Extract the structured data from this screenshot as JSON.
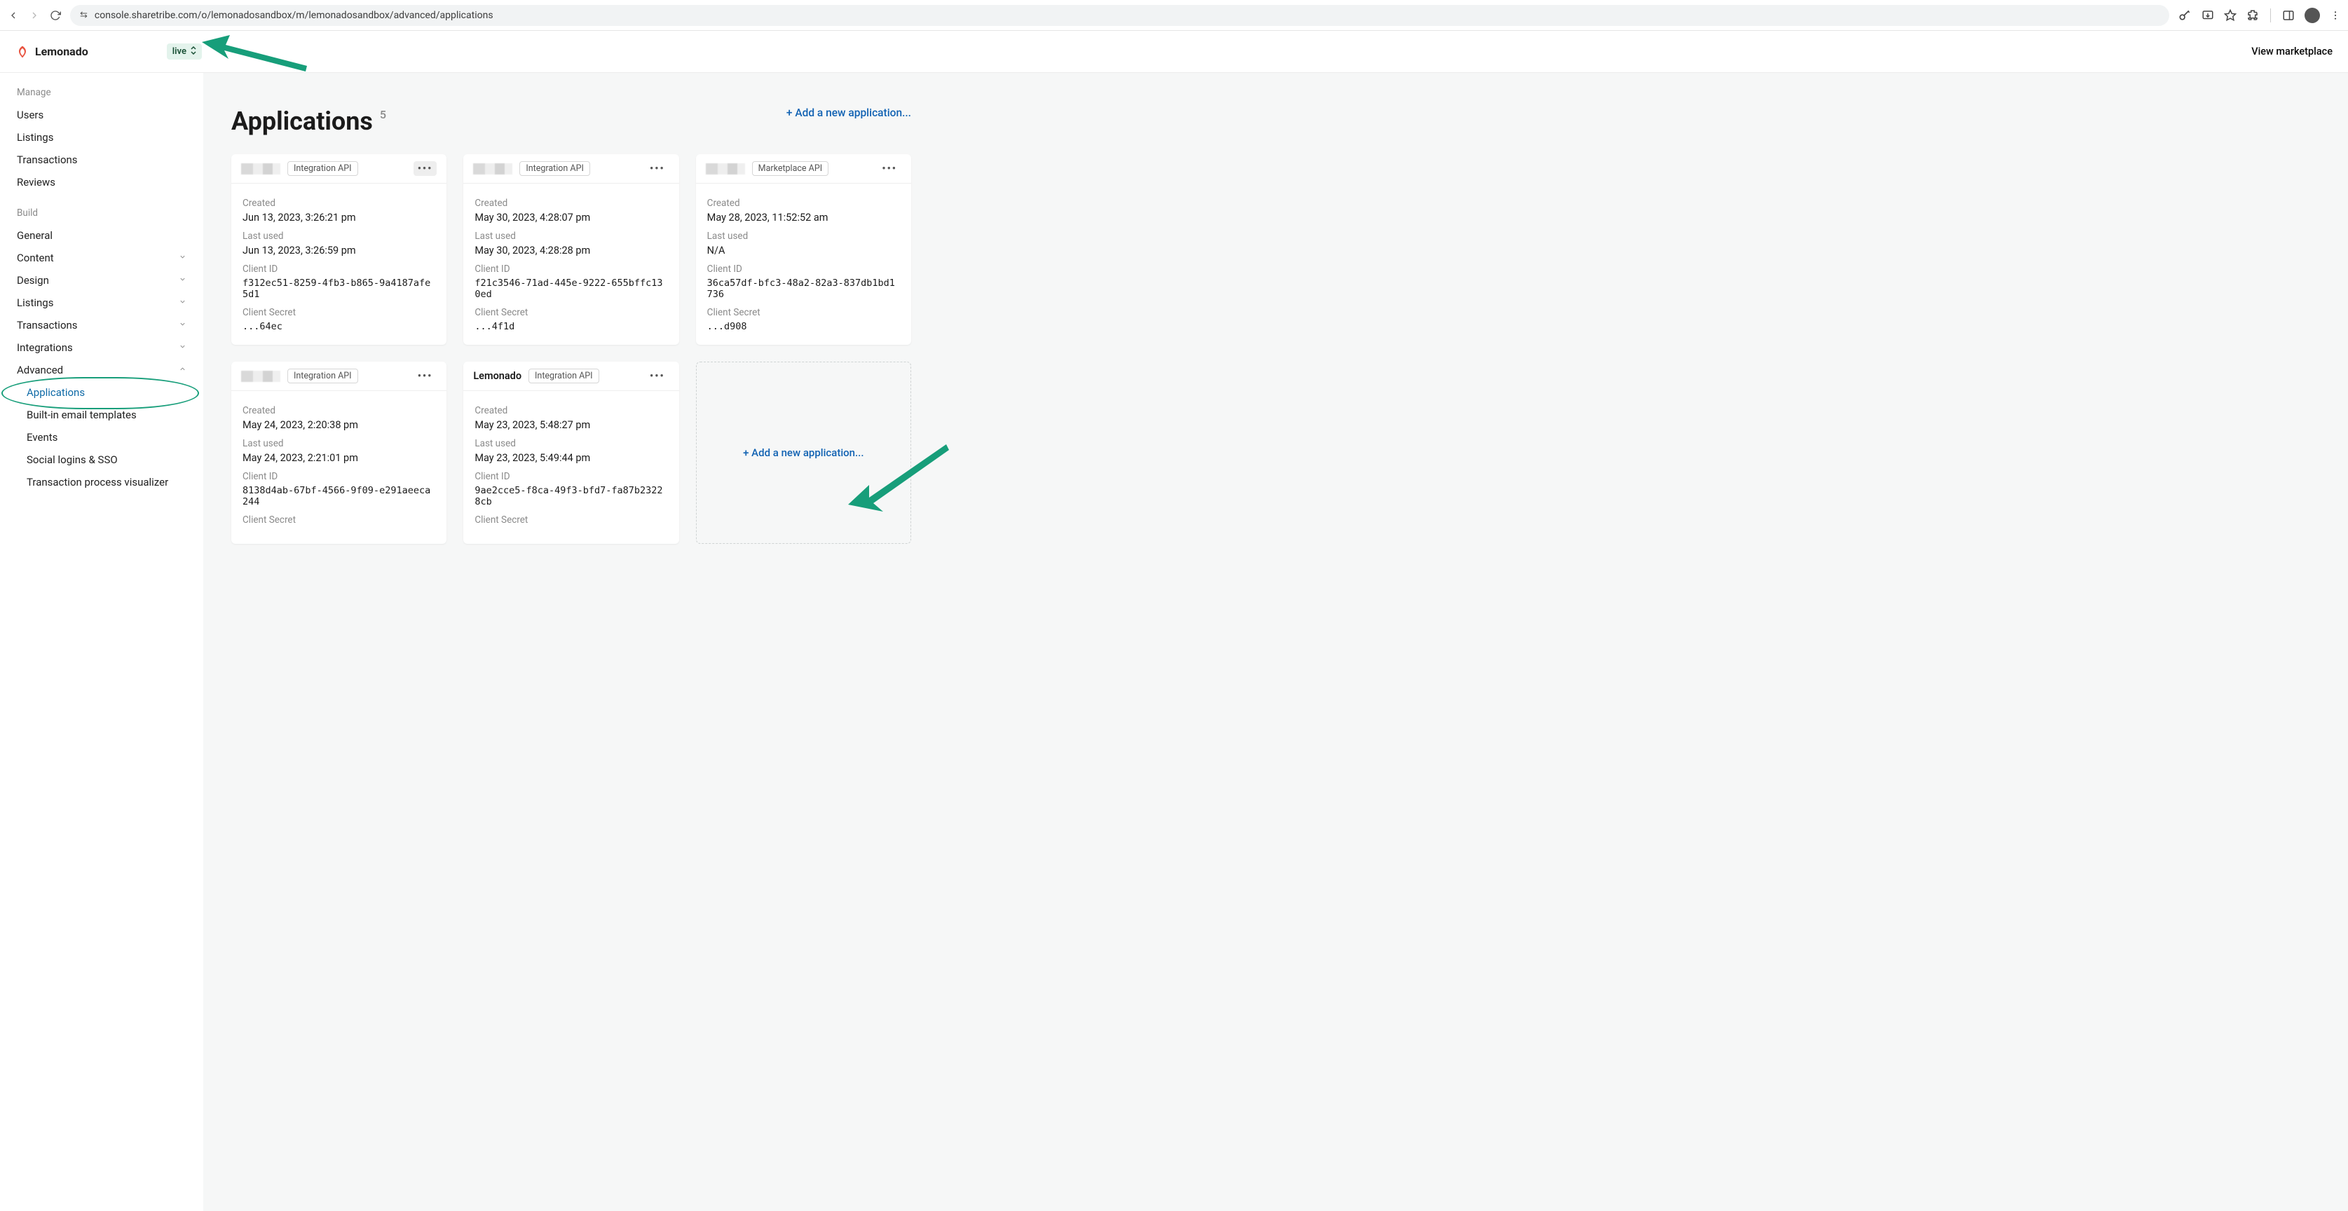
{
  "browser": {
    "url": "console.sharetribe.com/o/lemonadosandbox/m/lemonadosandbox/advanced/applications"
  },
  "header": {
    "workspace": "Lemonado",
    "environment": "live",
    "view_marketplace": "View marketplace"
  },
  "sidebar": {
    "manage_label": "Manage",
    "manage_items": [
      "Users",
      "Listings",
      "Transactions",
      "Reviews"
    ],
    "build_label": "Build",
    "build_items": [
      {
        "label": "General",
        "expandable": false
      },
      {
        "label": "Content",
        "expandable": true
      },
      {
        "label": "Design",
        "expandable": true
      },
      {
        "label": "Listings",
        "expandable": true
      },
      {
        "label": "Transactions",
        "expandable": true
      },
      {
        "label": "Integrations",
        "expandable": true
      },
      {
        "label": "Advanced",
        "expandable": true,
        "open": true
      }
    ],
    "advanced_children": [
      {
        "label": "Applications",
        "active": true
      },
      {
        "label": "Built-in email templates"
      },
      {
        "label": "Events"
      },
      {
        "label": "Social logins & SSO"
      },
      {
        "label": "Transaction process visualizer"
      }
    ]
  },
  "page": {
    "title": "Applications",
    "count": "5",
    "top_add_label": "+ Add a new application...",
    "card_add_label": "+ Add a new application...",
    "labels": {
      "created": "Created",
      "last_used": "Last used",
      "client_id": "Client ID",
      "client_secret": "Client Secret"
    },
    "apps": [
      {
        "name": null,
        "api_type": "Integration API",
        "menu_hovered": true,
        "created": "Jun 13, 2023, 3:26:21 pm",
        "last_used": "Jun 13, 2023, 3:26:59 pm",
        "client_id": "f312ec51-8259-4fb3-b865-9a4187afe5d1",
        "client_secret": "...64ec"
      },
      {
        "name": null,
        "api_type": "Integration API",
        "created": "May 30, 2023, 4:28:07 pm",
        "last_used": "May 30, 2023, 4:28:28 pm",
        "client_id": "f21c3546-71ad-445e-9222-655bffc130ed",
        "client_secret": "...4f1d"
      },
      {
        "name": null,
        "api_type": "Marketplace API",
        "created": "May 28, 2023, 11:52:52 am",
        "last_used": "N/A",
        "client_id": "36ca57df-bfc3-48a2-82a3-837db1bd1736",
        "client_secret": "...d908"
      },
      {
        "name": null,
        "api_type": "Integration API",
        "created": "May 24, 2023, 2:20:38 pm",
        "last_used": "May 24, 2023, 2:21:01 pm",
        "client_id": "8138d4ab-67bf-4566-9f09-e291aeeca244",
        "client_secret_label_only": true
      },
      {
        "name": "Lemonado",
        "api_type": "Integration API",
        "created": "May 23, 2023, 5:48:27 pm",
        "last_used": "May 23, 2023, 5:49:44 pm",
        "client_id": "9ae2cce5-f8ca-49f3-bfd7-fa87b23228cb",
        "client_secret_label_only": true
      }
    ]
  }
}
